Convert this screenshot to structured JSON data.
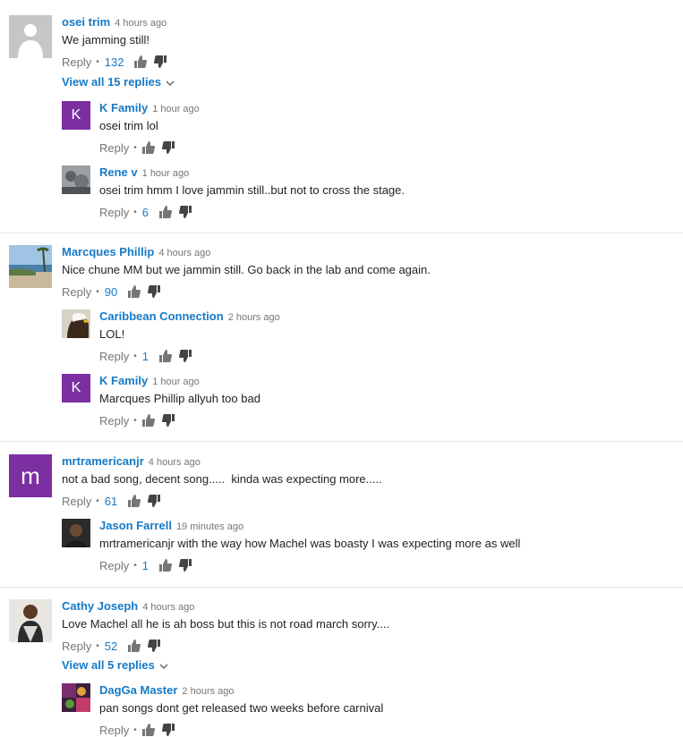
{
  "threads": [
    {
      "author": "osei trim",
      "time": "4 hours ago",
      "text": "We jamming still!",
      "reply_label": "Reply",
      "likes": "132",
      "view_replies": "View all 15 replies",
      "replies": [
        {
          "author": "K Family",
          "time": "1 hour ago",
          "text": "osei trim lol",
          "reply_label": "Reply",
          "likes": ""
        },
        {
          "author": "Rene v",
          "time": "1 hour ago",
          "text": "osei trim hmm I love jammin still..but not to cross the stage.",
          "reply_label": "Reply",
          "likes": "6"
        }
      ]
    },
    {
      "author": "Marcques Phillip",
      "time": "4 hours ago",
      "text": "Nice chune MM but we jammin still. Go back in the lab and come again.",
      "reply_label": "Reply",
      "likes": "90",
      "replies": [
        {
          "author": "Caribbean Connection",
          "time": "2 hours ago",
          "text": "LOL!",
          "reply_label": "Reply",
          "likes": "1"
        },
        {
          "author": "K Family",
          "time": "1 hour ago",
          "text": "Marcques Phillip allyuh too bad",
          "reply_label": "Reply",
          "likes": ""
        }
      ]
    },
    {
      "author": "mrtramericanjr",
      "time": "4 hours ago",
      "text": "not a bad song, decent song.....  kinda was expecting more.....",
      "reply_label": "Reply",
      "likes": "61",
      "replies": [
        {
          "author": "Jason Farrell",
          "time": "19 minutes ago",
          "text": "mrtramericanjr with the way how Machel was boasty I was expecting more as well",
          "reply_label": "Reply",
          "likes": "1"
        }
      ]
    },
    {
      "author": "Cathy Joseph",
      "time": "4 hours ago",
      "text": "Love Machel all he is ah boss but this is not road march sorry....",
      "reply_label": "Reply",
      "likes": "52",
      "view_replies": "View all 5 replies",
      "replies": [
        {
          "author": "DagGa Master",
          "time": "2 hours ago",
          "text": "pan songs dont get released two weeks before carnival",
          "reply_label": "Reply",
          "likes": ""
        }
      ]
    }
  ],
  "avatar_letters": {
    "k_family": "K",
    "mrtramericanjr": "m"
  },
  "colors": {
    "link_blue": "#167ac6",
    "meta_gray": "#767676",
    "purple_avatar": "#7b2fa0"
  },
  "icons": {
    "like": "thumbs-up-icon",
    "dislike": "thumbs-down-icon",
    "expand": "chevron-down-icon"
  }
}
